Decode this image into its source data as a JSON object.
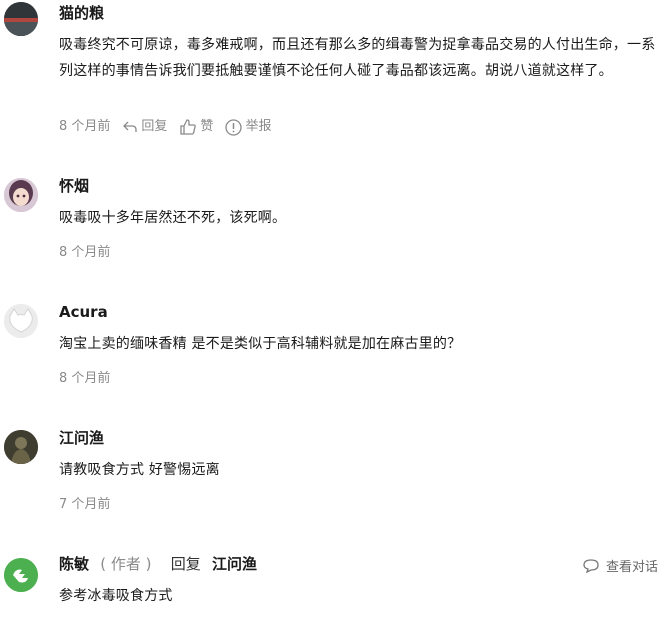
{
  "comments": [
    {
      "name": "猫的粮",
      "text": "吸毒终究不可原谅，毒多难戒啊，而且还有那么多的缉毒警为捉拿毒品交易的人付出生命，一系列这样的事情告诉我们要抵触要谨慎不论任何人碰了毒品都该远离。胡说八道就这样了。",
      "time": "8 个月前",
      "reply_label": "回复",
      "like_label": "赞",
      "report_label": "举报"
    },
    {
      "name": "怀烟",
      "text": "吸毒吸十多年居然还不死，该死啊。",
      "time": "8 个月前"
    },
    {
      "name": "Acura",
      "text": "淘宝上卖的缅味香精 是不是类似于高科辅料就是加在麻古里的？",
      "time": "8 个月前"
    },
    {
      "name": "江问渔",
      "text": "请教吸食方式 好警惕远离",
      "time": "7 个月前"
    },
    {
      "name": "陈敏",
      "author_tag": "( 作者 )",
      "reply_word": "回复",
      "reply_target": "江问渔",
      "view_conversation": "查看对话",
      "text": "参考冰毒吸食方式"
    }
  ],
  "colors": {
    "meta": "#8a8a8a",
    "text": "#1a1a1a",
    "avatar_green": "#4caf50"
  }
}
